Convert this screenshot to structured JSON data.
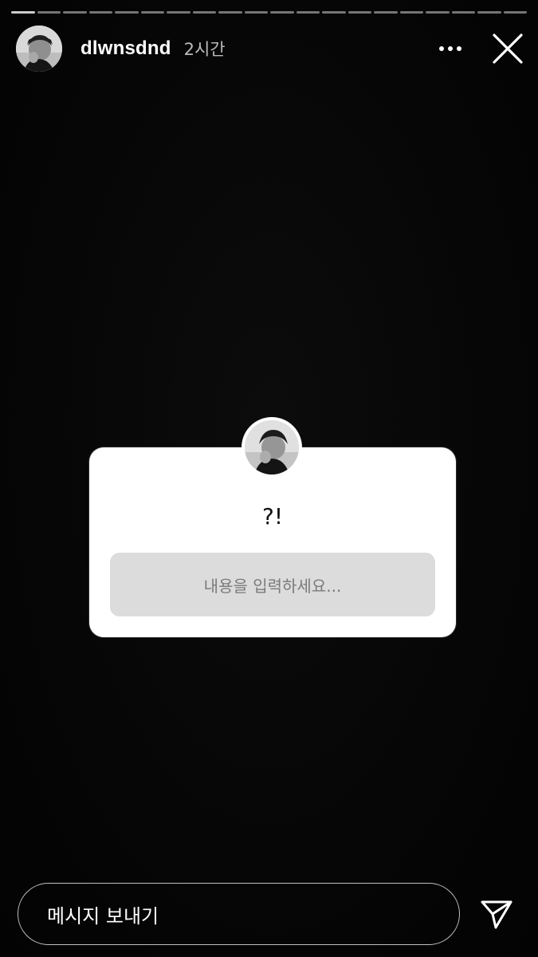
{
  "header": {
    "username": "dlwnsdnd",
    "time_ago": "2시간",
    "more_icon": "more-horizontal-icon",
    "close_icon": "close-icon"
  },
  "progress": {
    "segments": 20,
    "current": 1
  },
  "sticker": {
    "question": "?!",
    "placeholder": "내용을 입력하세요..."
  },
  "message": {
    "placeholder": "메시지 보내기",
    "send_icon": "send-icon"
  },
  "colors": {
    "background": "#060606",
    "sticker": "#ffffff",
    "answer_box": "#dcdcdc"
  }
}
